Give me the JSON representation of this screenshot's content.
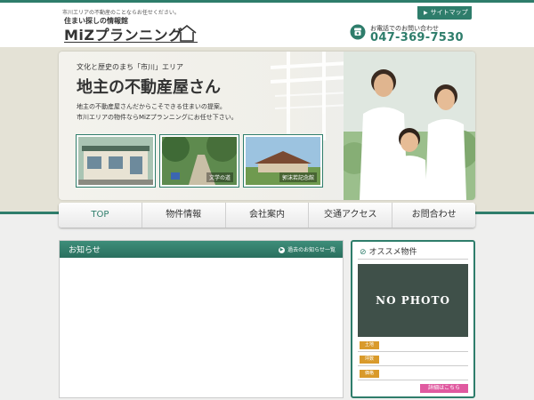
{
  "header": {
    "note": "市川エリアの不動産のことならお任せください。",
    "logo_tagline": "住まい探しの情報館",
    "logo_name": "MiZプランニング",
    "sitemap_label": "サイトマップ",
    "phone_label": "お電話でのお問い合わせ",
    "phone_number": "047-369-7530"
  },
  "hero": {
    "subtitle": "文化と歴史のまち「市川」エリア",
    "title": "地主の不動産屋さん",
    "text_line1": "地主の不動産屋さんだからこそできる住まいの提案。",
    "text_line2": "市川エリアの物件ならMiZプランニングにお任せ下さい。",
    "photo2_caption": "文学の道",
    "photo3_caption": "郭沫若記念館"
  },
  "nav": {
    "items": [
      "TOP",
      "物件情報",
      "会社案内",
      "交通アクセス",
      "お問合わせ"
    ]
  },
  "news": {
    "title": "お知らせ",
    "archive_link": "過去のお知らせ一覧"
  },
  "recommend": {
    "title": "オススメ物件",
    "no_photo": "NO PHOTO",
    "rows": [
      "土地",
      "坪数",
      "価格"
    ],
    "detail_button": "詳細はこちら"
  },
  "colors": {
    "brand_green": "#2e7d6b",
    "badge_orange": "#d99a2b",
    "detail_pink": "#e05aa0"
  }
}
